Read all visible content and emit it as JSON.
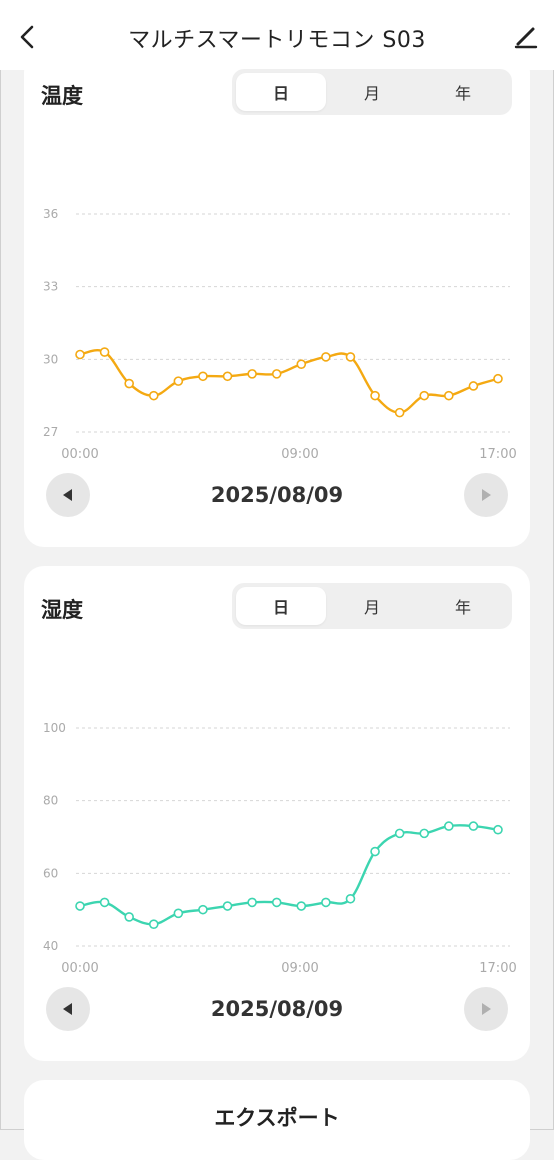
{
  "header": {
    "title": "マルチスマートリモコン S03"
  },
  "cards": [
    {
      "title": "温度",
      "segments": [
        "日",
        "月",
        "年"
      ],
      "selected": 0,
      "date": "2025/08/09",
      "color": "#f4a912",
      "chart_data": {
        "type": "line",
        "ylim": [
          27,
          36
        ],
        "y_ticks": [
          27,
          30,
          33,
          36
        ],
        "x_tick_labels": [
          "00:00",
          "09:00",
          "17:00"
        ],
        "series": [
          {
            "values": [
              30.2,
              30.3,
              29.0,
              28.5,
              29.1,
              29.3,
              29.3,
              29.4,
              29.4,
              29.8,
              30.1,
              30.1,
              28.5,
              27.8,
              28.5,
              28.5,
              28.9,
              29.2
            ]
          }
        ]
      }
    },
    {
      "title": "湿度",
      "segments": [
        "日",
        "月",
        "年"
      ],
      "selected": 0,
      "date": "2025/08/09",
      "color": "#3cd5b0",
      "chart_data": {
        "type": "line",
        "ylim": [
          40,
          100
        ],
        "y_ticks": [
          40,
          60,
          80,
          100
        ],
        "x_tick_labels": [
          "00:00",
          "09:00",
          "17:00"
        ],
        "series": [
          {
            "values": [
              51,
              52,
              48,
              46,
              49,
              50,
              51,
              52,
              52,
              51,
              52,
              53,
              66,
              71,
              71,
              73,
              73,
              72
            ]
          }
        ]
      }
    }
  ],
  "export": {
    "label": "エクスポート"
  }
}
